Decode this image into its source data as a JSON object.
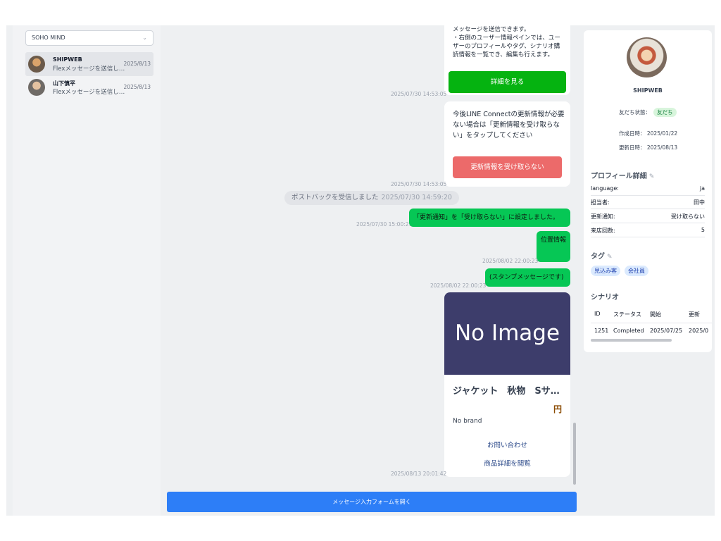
{
  "sidebar": {
    "account_select": "SOHO MIND",
    "conversations": [
      {
        "name": "SHIPWEB",
        "preview": "Flexメッセージを送信し…",
        "date": "2025/8/13"
      },
      {
        "name": "山下慎平",
        "preview": "Flexメッセージを送信し…",
        "date": "2025/8/13"
      }
    ]
  },
  "chat": {
    "card1": {
      "text_line1": "メッセージを送信できます。",
      "text_line2": "・右側のユーザー情報ペインでは、ユー",
      "text_line3": "ザーのプロフィールやタグ、シナリオ購",
      "text_line4": "読情報を一覧でき、編集も行えます。",
      "button": "詳細を見る",
      "time": "2025/07/30 14:53:05"
    },
    "card2": {
      "text_line1": "今後LINE Connectの更新情報が必要",
      "text_line2": "ない場合は「更新情報を受け取らな",
      "text_line3": "い」をタップしてください",
      "button": "更新情報を受け取らない",
      "time": "2025/07/30 14:53:05"
    },
    "postback": {
      "text": "ポストバックを受信しました",
      "time": "2025/07/30 14:59:20"
    },
    "msg1": {
      "text": "「更新通知」を「受け取らない」に設定しました。",
      "time": "2025/07/30 15:00:21"
    },
    "msg2": {
      "text": "位置情報",
      "time": "2025/08/02 22:00:23"
    },
    "msg3": {
      "text": "(スタンプメッセージです)",
      "time": "2025/08/02 22:00:23"
    },
    "product": {
      "image_text": "No Image",
      "title": "ジャケット　秋物　Sサ…",
      "price": "円",
      "brand": "No brand",
      "link1": "お問い合わせ",
      "link2": "商品詳細を閲覧",
      "time": "2025/08/13 20:01:42"
    },
    "open_form_button": "メッセージ入力フォームを開く"
  },
  "profile": {
    "name": "SHIPWEB",
    "friend_status_label": "友だち状態：",
    "friend_status": "友だち",
    "created_label": "作成日時：",
    "created": "2025/01/22",
    "updated_label": "更新日時：",
    "updated": "2025/08/13",
    "details_title": "プロフィール詳細",
    "details": [
      {
        "key": "language:",
        "value": "ja"
      },
      {
        "key": "担当者:",
        "value": "田中"
      },
      {
        "key": "更新通知:",
        "value": "受け取らない"
      },
      {
        "key": "来店回数:",
        "value": "5"
      }
    ],
    "tags_title": "タグ",
    "tags": [
      "見込み客",
      "会社員"
    ],
    "scenario_title": "シナリオ",
    "scenario_headers": [
      "ID",
      "ステータス",
      "開始",
      "更新"
    ],
    "scenario_row": [
      "1251",
      "Completed",
      "2025/07/25",
      "2025/0"
    ]
  },
  "colors": {
    "line_green": "#06c755",
    "button_blue": "#2d7ef7",
    "product_image_bg": "#3d3d6b",
    "decline_red": "#ec6a6a"
  }
}
